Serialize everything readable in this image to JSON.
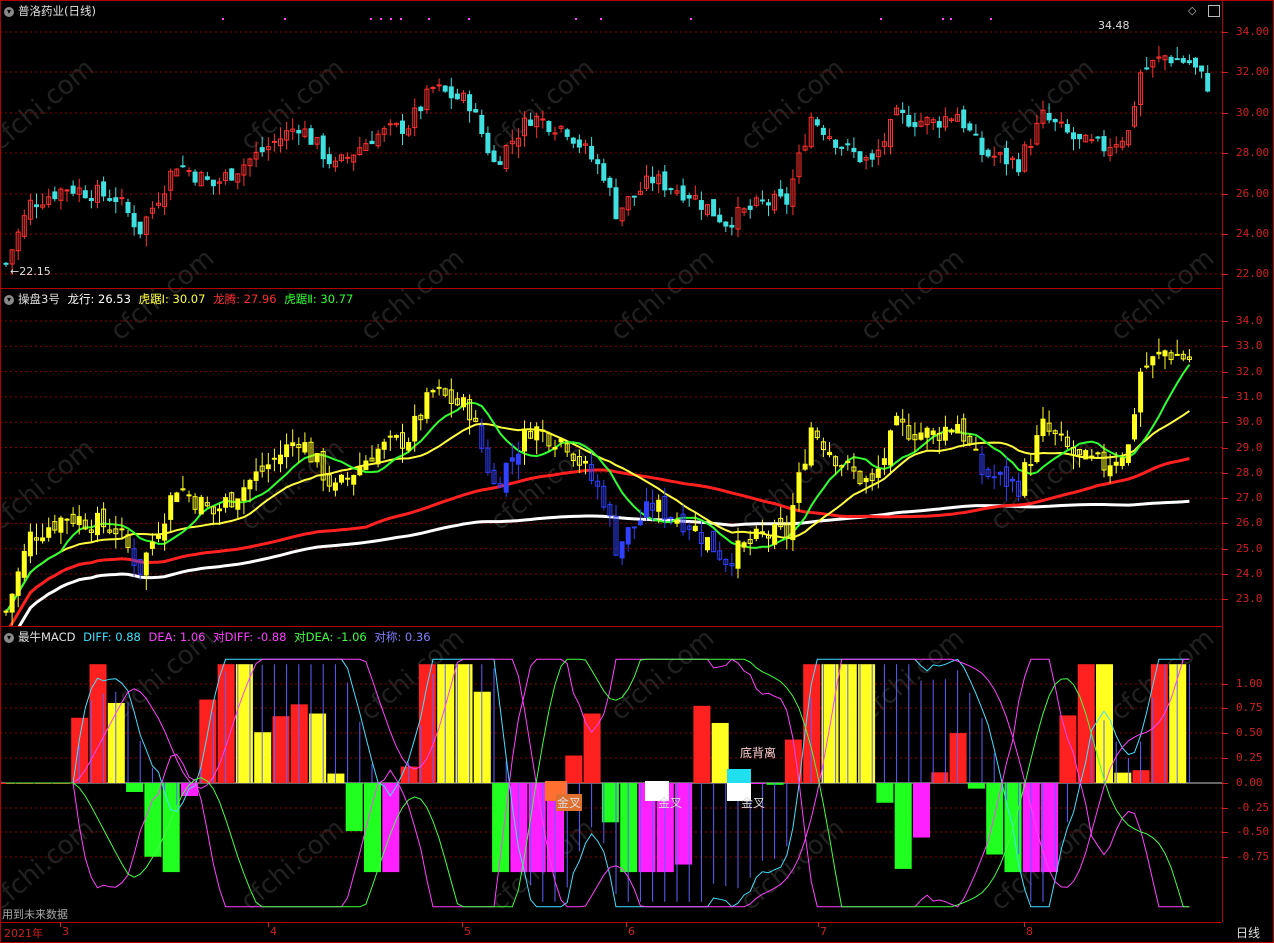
{
  "main": {
    "title": "普洛药业(日线)",
    "high_label": "34.48",
    "low_label": "←22.15",
    "ylabels": [
      "34.00",
      "32.00",
      "30.00",
      "28.00",
      "26.00",
      "24.00",
      "22.00"
    ]
  },
  "panel2": {
    "name": "操盘3号",
    "items": [
      {
        "label": "龙行: 26.53",
        "color": "#ffffff"
      },
      {
        "label": "虎踞Ⅰ: 30.07",
        "color": "#ffff40"
      },
      {
        "label": "龙腾: 27.96",
        "color": "#ff3030"
      },
      {
        "label": "虎踞Ⅱ: 30.77",
        "color": "#30ff30"
      }
    ],
    "ylabels": [
      "34.0",
      "33.0",
      "32.0",
      "31.0",
      "30.0",
      "29.0",
      "28.0",
      "27.0",
      "26.0",
      "25.0",
      "24.0",
      "23.0"
    ]
  },
  "panel3": {
    "name": "最牛MACD",
    "items": [
      {
        "label": "DIFF: 0.88",
        "color": "#40e0ff"
      },
      {
        "label": "DEA: 1.06",
        "color": "#ff40ff"
      },
      {
        "label": "对DIFF: -0.88",
        "color": "#ff40ff"
      },
      {
        "label": "对DEA: -1.06",
        "color": "#40ff40"
      },
      {
        "label": "对称: 0.36",
        "color": "#8080ff"
      }
    ],
    "ylabels": [
      "1.00",
      "0.75",
      "0.50",
      "0.25",
      "0.00",
      "-0.25",
      "-0.50",
      "-0.75"
    ],
    "annotations": [
      "金叉",
      "金叉",
      "金叉",
      "底背离"
    ],
    "note": "用到未来数据"
  },
  "xaxis": {
    "labels": [
      "2021年",
      "3",
      "4",
      "5",
      "6",
      "7",
      "8"
    ],
    "period_button": "日线"
  },
  "watermark": "cfchi.com",
  "colors": {
    "up": "#ff3030",
    "down": "#40e0e0",
    "grid": "#b00000",
    "axis_text": "#d02020"
  }
}
